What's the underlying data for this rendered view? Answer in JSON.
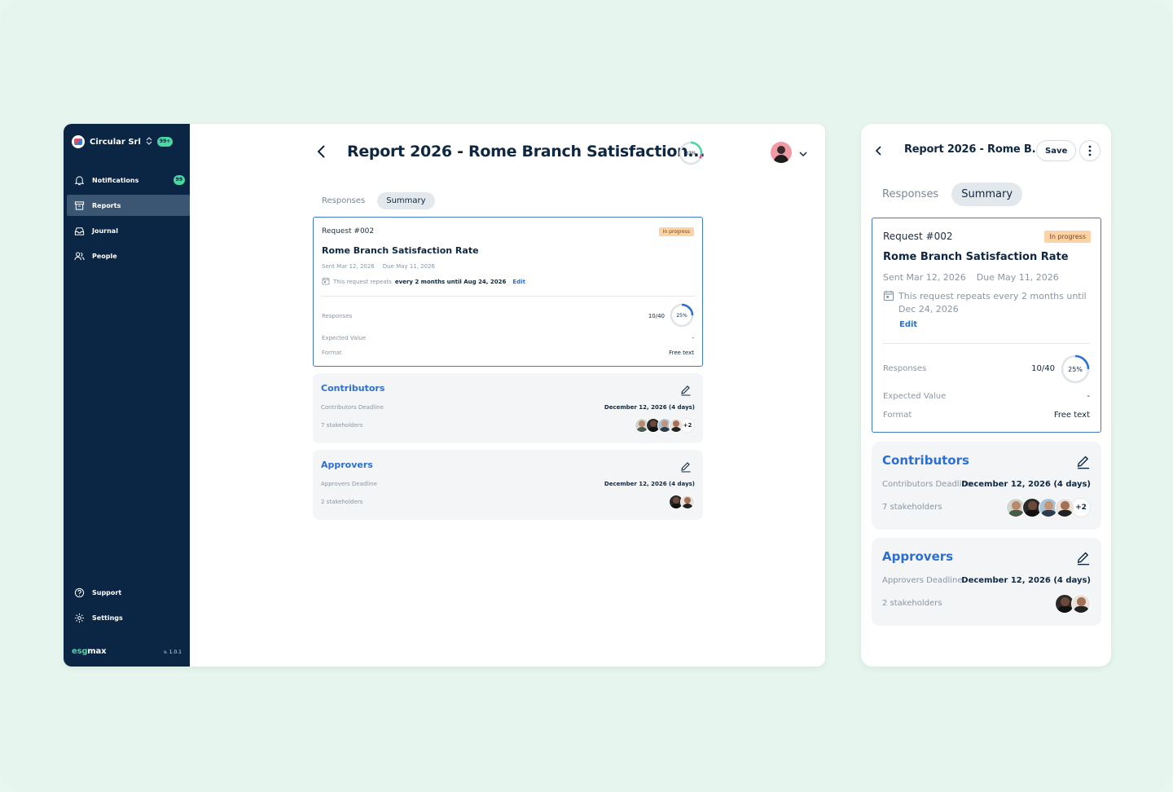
{
  "colors": {
    "sidebar_bg": "#0b2545",
    "accent_blue": "#2d6fd1",
    "green_badge": "#4cd6a1",
    "progress_pill": "#fbd3a6"
  },
  "sidebar": {
    "org_name": "Circular Srl",
    "org_badge": "99+",
    "items": [
      {
        "label": "Notifications",
        "icon": "bell-icon",
        "badge": "99"
      },
      {
        "label": "Reports",
        "icon": "archive-icon"
      },
      {
        "label": "Journal",
        "icon": "inbox-icon"
      },
      {
        "label": "People",
        "icon": "users-icon"
      }
    ],
    "bottom_items": [
      {
        "label": "Support",
        "icon": "help-circle-icon"
      },
      {
        "label": "Settings",
        "icon": "gear-icon"
      }
    ],
    "brand_prefix": "esg",
    "brand_suffix": "max",
    "version": "v. 1.0.1"
  },
  "header": {
    "title": "Report 2026 - Rome Branch Satisfaction...",
    "progress_label": "33%",
    "progress_value": 0.33
  },
  "tabs": [
    {
      "label": "Responses",
      "active": false
    },
    {
      "label": "Summary",
      "active": true
    }
  ],
  "request": {
    "id": "Request #002",
    "status": "In progress",
    "name": "Rome Branch Satisfaction Rate",
    "sent": "Sent Mar 12, 2026",
    "due": "Due May 11, 2026",
    "repeat_prefix": "This request repeats",
    "repeat_detail": "every 2 months until Aug 24, 2026",
    "edit_label": "Edit",
    "responses_label": "Responses",
    "responses_count": "10/40",
    "responses_pct_label": "25%",
    "responses_pct": 0.25,
    "expected_label": "Expected Value",
    "expected_value": "-",
    "format_label": "Format",
    "format_value": "Free text"
  },
  "contributors": {
    "title": "Contributors",
    "deadline_label": "Contributors Deadline",
    "deadline_value": "December 12, 2026 (4 days)",
    "stakeholders": "7 stakeholders",
    "more": "+2"
  },
  "approvers": {
    "title": "Approvers",
    "deadline_label": "Approvers Deadline",
    "deadline_value": "December 12, 2026 (4 days)",
    "stakeholders": "2 stakeholders"
  },
  "mobile": {
    "title": "Report 2026 - Rome B...",
    "save_label": "Save",
    "repeat_text": "This request repeats every 2 months until Dec 24, 2026",
    "edit_label": "Edit"
  }
}
